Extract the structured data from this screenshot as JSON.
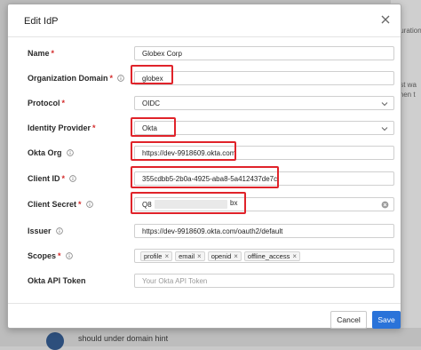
{
  "background": {
    "peek_lines": [
      "iguration",
      "List wa",
      "when t"
    ],
    "bottom_text": "should under domain hint"
  },
  "modal": {
    "title": "Edit IdP",
    "fields": {
      "name": {
        "label": "Name",
        "value": "Globex Corp"
      },
      "org_domain": {
        "label": "Organization Domain",
        "value": "globex"
      },
      "protocol": {
        "label": "Protocol",
        "value": "OIDC"
      },
      "identity_provider": {
        "label": "Identity Provider",
        "value": "Okta"
      },
      "okta_org": {
        "label": "Okta Org",
        "value": "https://dev-9918609.okta.com"
      },
      "client_id": {
        "label": "Client ID",
        "value": "355cdbb5-2b0a-4925-aba8-5a412437de7c"
      },
      "client_secret": {
        "label": "Client Secret",
        "value_prefix": "Q8",
        "value_suffix": "bx"
      },
      "issuer": {
        "label": "Issuer",
        "value": "https://dev-9918609.okta.com/oauth2/default"
      },
      "scopes": {
        "label": "Scopes",
        "chips": [
          "profile",
          "email",
          "openid",
          "offline_access"
        ]
      },
      "okta_api_token": {
        "label": "Okta API Token",
        "placeholder": "Your Okta API Token"
      }
    },
    "required_mark": "*",
    "chip_remove": "×",
    "buttons": {
      "cancel": "Cancel",
      "save": "Save"
    }
  },
  "colors": {
    "highlight": "#e0232a",
    "primary": "#2a73d9",
    "required": "#d42b2b"
  }
}
